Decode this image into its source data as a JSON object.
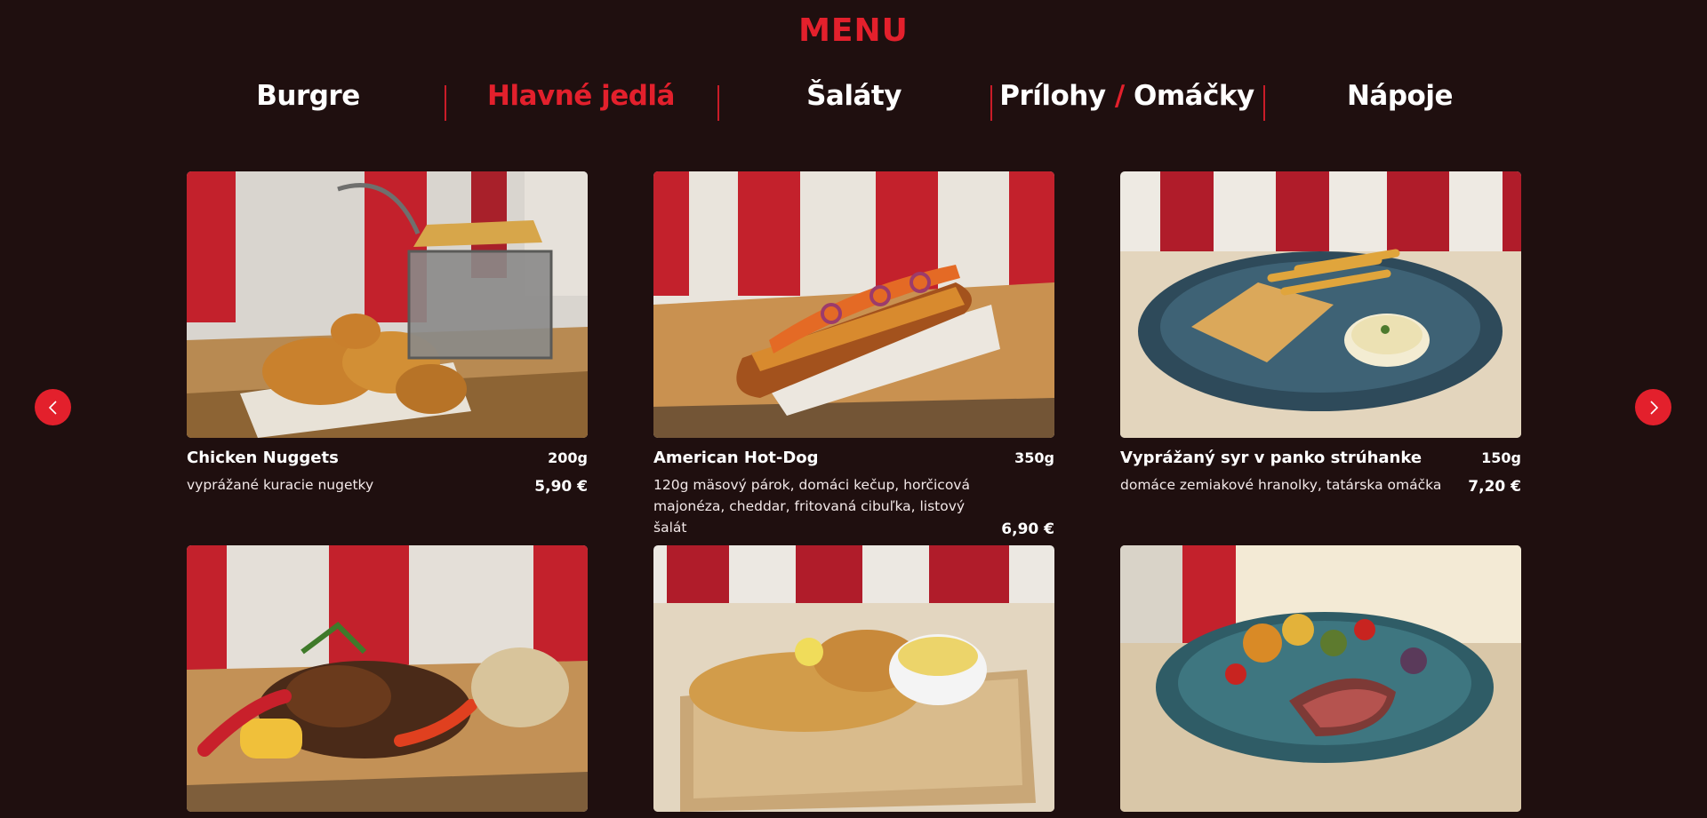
{
  "menu": {
    "title": "MENU"
  },
  "tabs": {
    "burgre": "Burgre",
    "hlavne": "Hlavné jedlá",
    "salaty": "Šaláty",
    "prilohy": "Prílohy",
    "separator": "/",
    "omacky": "Omáčky",
    "napoje": "Nápoje"
  },
  "colors": {
    "accent": "#e3202c",
    "background": "#1f0f0f",
    "text": "#ffffff"
  },
  "icons": {
    "prev": "chevron-left-icon",
    "next": "chevron-right-icon"
  },
  "items": [
    {
      "name": "Chicken Nuggets",
      "weight": "200g",
      "desc": "vyprážané kuracie nugetky",
      "price": "5,90 €"
    },
    {
      "name": "American Hot-Dog",
      "weight": "350g",
      "desc": "120g mäsový párok, domáci kečup, horčicová majonéza, cheddar, fritovaná cibuľka, listový šalát",
      "price": "6,90 €"
    },
    {
      "name": "Vyprážaný syr v panko strúhanke",
      "weight": "150g",
      "desc": "domáce zemiakové hranolky, tatárska omáčka",
      "price": "7,20 €"
    }
  ]
}
